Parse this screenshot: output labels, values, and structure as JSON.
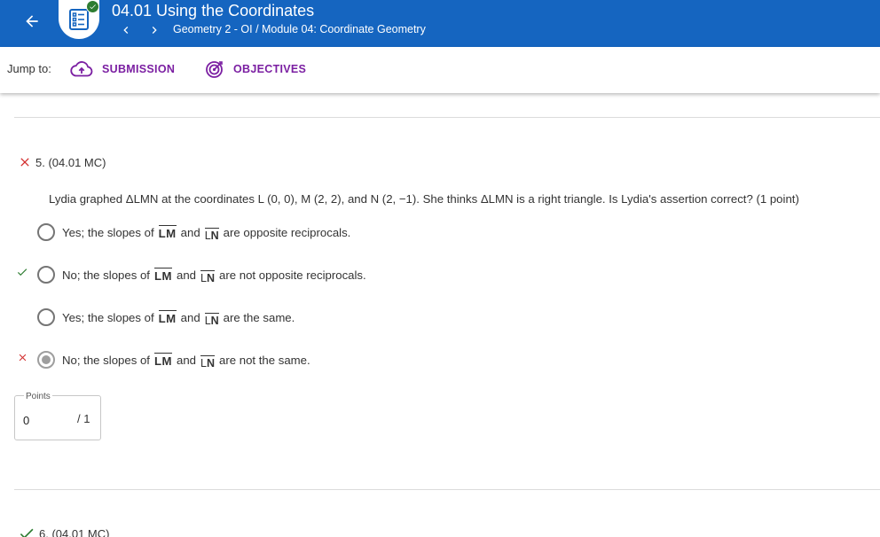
{
  "header": {
    "title": "04.01 Using the Coordinates",
    "breadcrumb": "Geometry 2 - OI / Module 04: Coordinate Geometry"
  },
  "jump": {
    "label": "Jump to:",
    "submission": "SUBMISSION",
    "objectives": "OBJECTIVES"
  },
  "question": {
    "number": "5. (04.01 MC)",
    "text": "Lydia graphed ΔLMN at the coordinates L (0, 0), M (2, 2), and N (2, −1). She thinks ΔLMN is a right triangle. Is Lydia's assertion correct? (1 point)",
    "options": [
      {
        "prefix": "Yes; the slopes of",
        "seg1": "LM",
        "conj": "and",
        "seg2_l": "L",
        "seg2_n": "N",
        "suffix": "are opposite reciprocals.",
        "selected": false,
        "mark": ""
      },
      {
        "prefix": "No; the slopes of",
        "seg1": "LM",
        "conj": "and",
        "seg2_l": "L",
        "seg2_n": "N",
        "suffix": "are not opposite reciprocals.",
        "selected": false,
        "mark": "correct"
      },
      {
        "prefix": "Yes; the slopes of",
        "seg1": "LM",
        "conj": "and",
        "seg2_l": "L",
        "seg2_n": "N",
        "suffix": "are the same.",
        "selected": false,
        "mark": ""
      },
      {
        "prefix": "No; the slopes of",
        "seg1": "LM",
        "conj": "and",
        "seg2_l": "L",
        "seg2_n": "N",
        "suffix": "are not the same.",
        "selected": true,
        "mark": "incorrect"
      }
    ],
    "result": "incorrect"
  },
  "points": {
    "label": "Points",
    "value": "0",
    "max": "/ 1"
  },
  "next_question": {
    "number": "6. (04.01 MC)",
    "result": "correct"
  },
  "colors": {
    "header_bg": "#1565c0",
    "link": "#7b1fa2",
    "correct": "#2e7d32",
    "incorrect": "#d32f2f"
  }
}
